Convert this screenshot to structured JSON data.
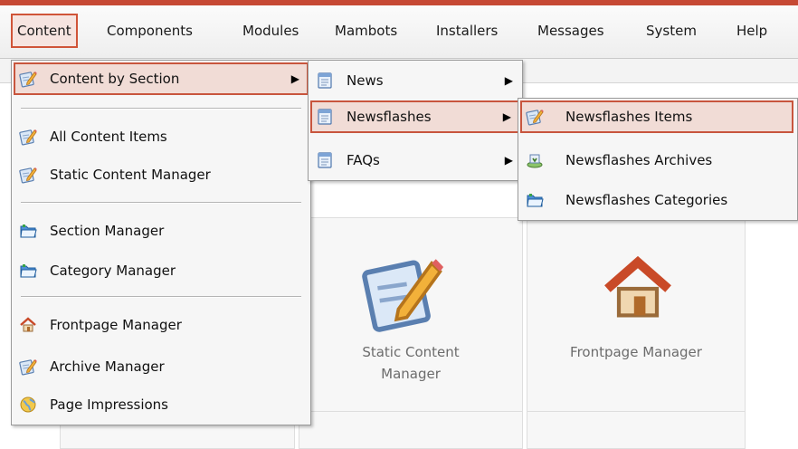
{
  "menubar": {
    "items": [
      {
        "label": "Content"
      },
      {
        "label": "Components"
      },
      {
        "label": "Modules"
      },
      {
        "label": "Mambots"
      },
      {
        "label": "Installers"
      },
      {
        "label": "Messages"
      },
      {
        "label": "System"
      },
      {
        "label": "Help"
      }
    ]
  },
  "content_menu": {
    "items": [
      {
        "label": "Content by Section",
        "icon": "edit-icon"
      },
      {
        "label": "All Content Items",
        "icon": "edit-icon"
      },
      {
        "label": "Static Content Manager",
        "icon": "edit-icon"
      },
      {
        "label": "Section Manager",
        "icon": "folder-icon"
      },
      {
        "label": "Category Manager",
        "icon": "folder-icon"
      },
      {
        "label": "Frontpage Manager",
        "icon": "home-icon"
      },
      {
        "label": "Archive Manager",
        "icon": "edit-icon"
      },
      {
        "label": "Page Impressions",
        "icon": "globe-icon"
      }
    ]
  },
  "section_menu": {
    "items": [
      {
        "label": "News",
        "icon": "document-icon"
      },
      {
        "label": "Newsflashes",
        "icon": "document-icon"
      },
      {
        "label": "FAQs",
        "icon": "document-icon"
      }
    ]
  },
  "newsflashes_menu": {
    "items": [
      {
        "label": "Newsflashes Items",
        "icon": "edit-icon"
      },
      {
        "label": "Newsflashes Archives",
        "icon": "archive-icon"
      },
      {
        "label": "Newsflashes Categories",
        "icon": "folder-icon"
      }
    ]
  },
  "panels": {
    "static_content": "Static Content Manager",
    "frontpage": "Frontpage Manager"
  },
  "colors": {
    "accent": "#c8553d",
    "highlight_bg": "#f1dcd6",
    "menu_bg": "#f6f6f6"
  }
}
